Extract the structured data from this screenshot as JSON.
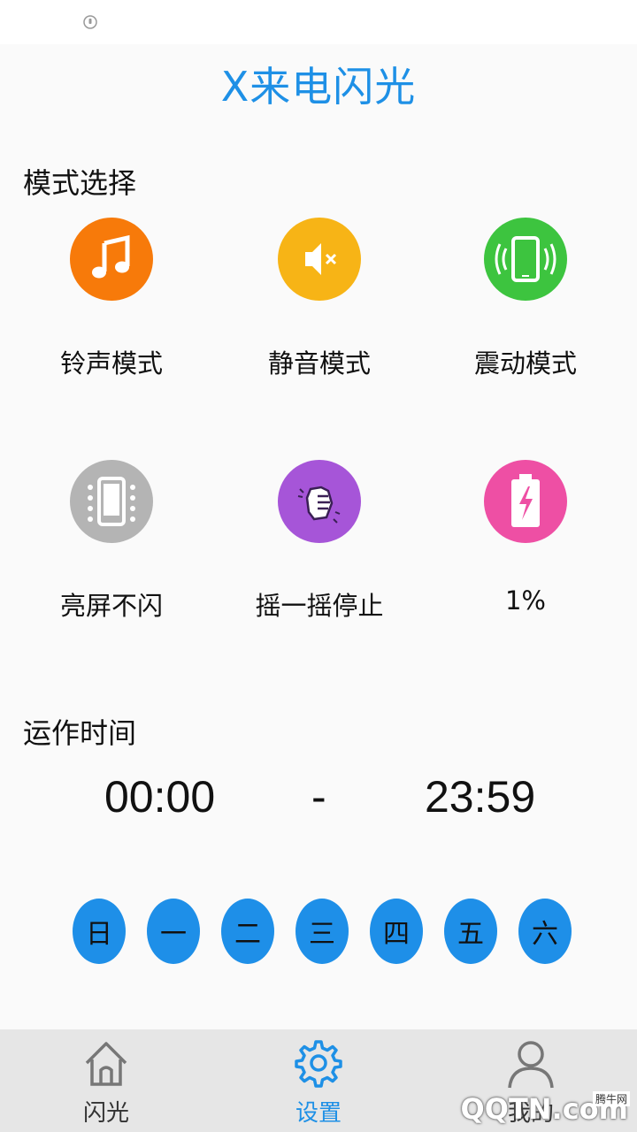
{
  "app": {
    "title": "X来电闪光"
  },
  "mode_section": {
    "title": "模式选择"
  },
  "modes": [
    {
      "label": "铃声模式",
      "icon": "music-note-icon",
      "color": "#f77a0a"
    },
    {
      "label": "静音模式",
      "icon": "mute-speaker-icon",
      "color": "#f7b416"
    },
    {
      "label": "震动模式",
      "icon": "vibrate-phone-icon",
      "color": "#3dc43f"
    },
    {
      "label": "亮屏不闪",
      "icon": "screen-on-icon",
      "color": "#b4b4b4"
    },
    {
      "label": "摇一摇停止",
      "icon": "shake-hand-icon",
      "color": "#a655d8"
    },
    {
      "label": "1%",
      "icon": "battery-low-icon",
      "color": "#ee4fa4"
    }
  ],
  "schedule": {
    "title": "运作时间",
    "start": "00:00",
    "separator": "-",
    "end": "23:59",
    "days": [
      "日",
      "一",
      "二",
      "三",
      "四",
      "五",
      "六"
    ],
    "day_color": "#1e8fe8"
  },
  "nav": {
    "items": [
      {
        "label": "闪光",
        "icon": "home-icon",
        "active": false
      },
      {
        "label": "设置",
        "icon": "gear-icon",
        "active": true
      },
      {
        "label": "我的",
        "icon": "user-icon",
        "active": false
      }
    ]
  },
  "watermark": {
    "text": "QQTN.com",
    "small": "腾牛网"
  }
}
